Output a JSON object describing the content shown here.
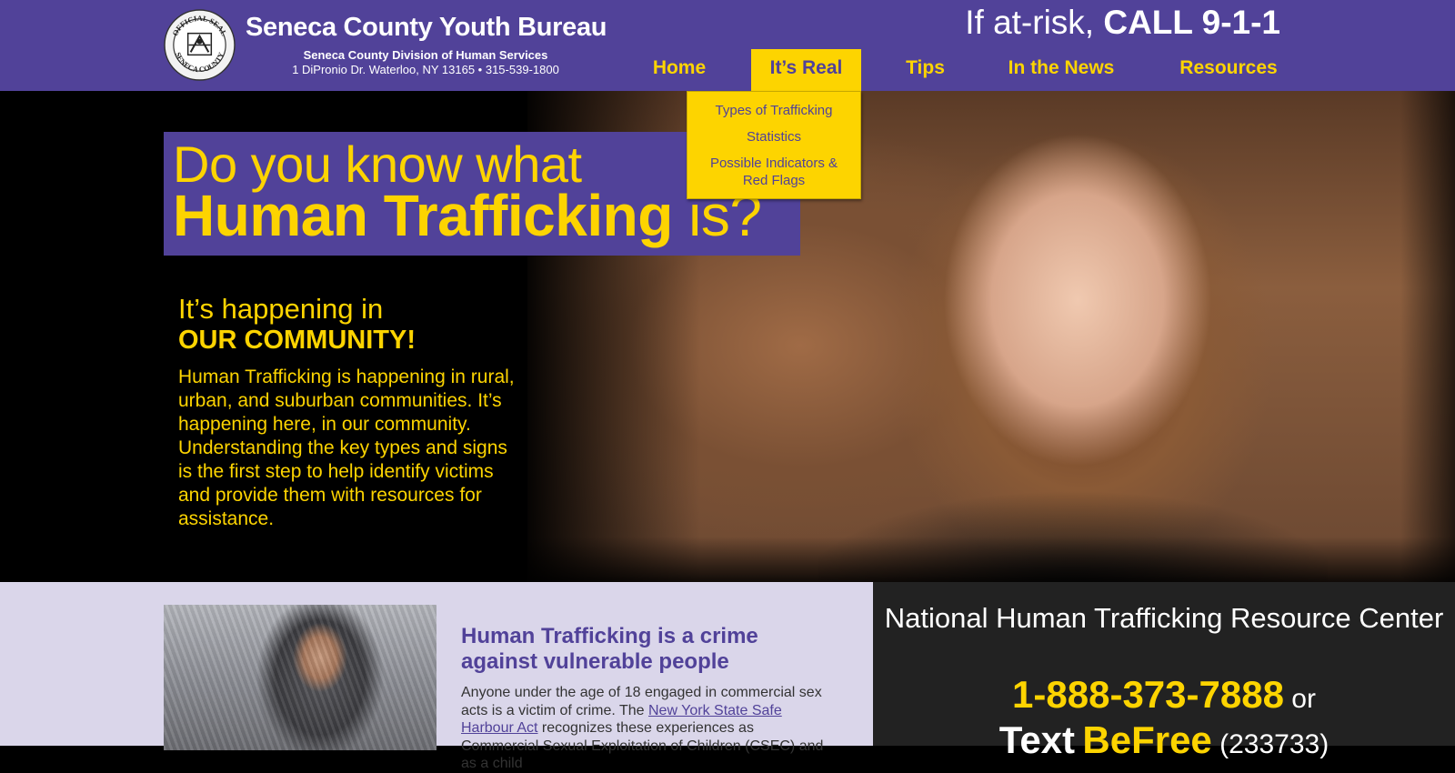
{
  "header": {
    "title": "Seneca County Youth Bureau",
    "subtitle": "Seneca County Division of Human Services",
    "address": "1 DiPronio Dr. Waterloo, NY 13165  •  315-539-1800",
    "callout_prefix": "If at-risk,",
    "callout_action": "CALL 9-1-1",
    "seal_top": "OFFICIAL SEAL",
    "seal_bottom": "SENECA COUNTY"
  },
  "nav": {
    "items": [
      {
        "label": "Home"
      },
      {
        "label": "It’s Real",
        "active": true
      },
      {
        "label": "Tips"
      },
      {
        "label": "In the News"
      },
      {
        "label": "Resources"
      }
    ],
    "dropdown": [
      {
        "label": "Types of Trafficking"
      },
      {
        "label": "Statistics"
      },
      {
        "label": "Possible Indicators &"
      },
      {
        "label": "Red Flags"
      }
    ]
  },
  "hero": {
    "title_line1": "Do you know what",
    "title_bold": "Human Trafficking",
    "title_tail": " is?",
    "happening": "It’s happening in",
    "community": "OUR COMMUNITY!",
    "paragraph": "Human Trafficking is happening in rural, urban, and suburban communities. It’s happening here, in our community. Understanding the key types and signs is the first step to help identify victims and provide them with resources for assistance."
  },
  "crime": {
    "title": "Human Trafficking is a crime against vulnerable people",
    "text_before": "Anyone under the age of 18 engaged in commercial sex acts is a victim of crime. The ",
    "link": "New York State Safe Harbour Act",
    "text_after": " recognizes these experiences as Commercial Sexual Exploitation of Children (CSEC) and as a child"
  },
  "resource_center": {
    "title": "National Human Trafficking Resource Center",
    "phone": "1-888-373-7888",
    "or": " or",
    "text_word": "Text",
    "text_keyword": "BeFree",
    "text_code": "(233733)"
  },
  "colors": {
    "brand_purple": "#514299",
    "brand_yellow": "#fdd400",
    "lavender": "#dad6ea",
    "dark_panel": "#222222"
  }
}
